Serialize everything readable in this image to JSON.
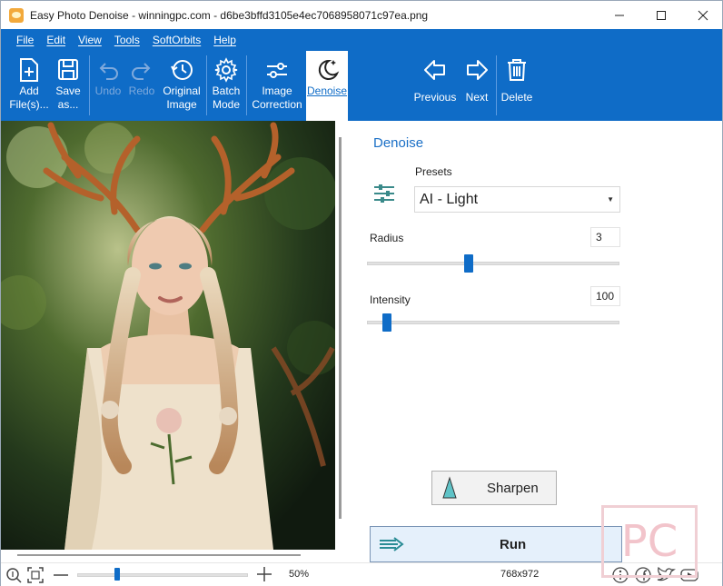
{
  "window": {
    "title": "Easy Photo Denoise - winningpc.com - d6be3bffd3105e4ec7068958071c97ea.png",
    "minimize_glyph": "—",
    "maximize_glyph": "☐",
    "close_glyph": "✕"
  },
  "menu": [
    "File",
    "Edit",
    "View",
    "Tools",
    "SoftOrbits",
    "Help"
  ],
  "toolbar": {
    "add_files": "Add File(s)...",
    "save_as": "Save as...",
    "undo": "Undo",
    "redo": "Redo",
    "original_image": "Original Image",
    "batch_mode": "Batch Mode",
    "image_correction": "Image Correction",
    "denoise": "Denoise",
    "previous": "Previous",
    "next": "Next",
    "delete": "Delete"
  },
  "panel": {
    "title": "Denoise",
    "presets_label": "Presets",
    "presets_value": "AI - Light",
    "radius_label": "Radius",
    "radius_value": "3",
    "radius_slider": 0.4,
    "intensity_label": "Intensity",
    "intensity_value": "100",
    "intensity_slider": 0.06,
    "sharpen_label": "Sharpen",
    "run_label": "Run"
  },
  "statusbar": {
    "zoom": "50%",
    "zoom_slider": 0.22,
    "dimensions": "768x972"
  },
  "colors": {
    "accent": "#0f6cc7",
    "panel_title": "#1a6fc6"
  }
}
